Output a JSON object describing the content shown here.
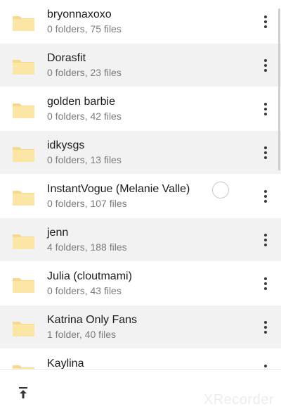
{
  "folders": [
    {
      "name": "bryonnaxoxo",
      "meta": "0 folders, 75 files"
    },
    {
      "name": "Dorasfit",
      "meta": "0 folders, 23 files"
    },
    {
      "name": "golden barbie",
      "meta": "0 folders, 42 files"
    },
    {
      "name": "idkysgs",
      "meta": "0 folders, 13 files"
    },
    {
      "name": "InstantVogue (Melanie Valle)",
      "meta": "0 folders, 107 files"
    },
    {
      "name": "jenn",
      "meta": "4 folders, 188 files"
    },
    {
      "name": "Julia (cloutmami)",
      "meta": "0 folders, 43 files"
    },
    {
      "name": "Katrina Only Fans",
      "meta": "1 folder, 40 files"
    },
    {
      "name": "Kaylina",
      "meta": ""
    }
  ],
  "icons": {
    "folder": "folder-icon",
    "more": "more-vertical-icon",
    "upload": "upload-to-top-icon"
  },
  "watermark": "XRecorder",
  "colors": {
    "folder_fill": "#fbe6a6",
    "folder_tab": "#f6d98a",
    "row_alt_bg": "#f2f2f2"
  }
}
